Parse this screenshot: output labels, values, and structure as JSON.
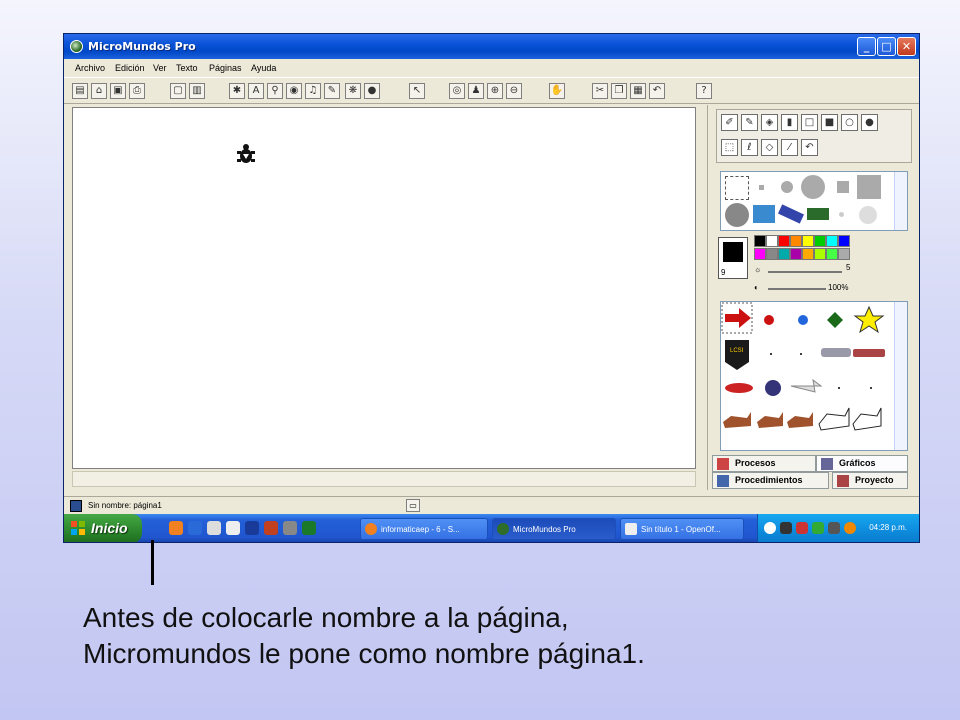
{
  "window": {
    "title": "MicroMundos Pro",
    "buttons": {
      "minimize": "_",
      "maximize": "□",
      "close": "✕"
    }
  },
  "menu": [
    "Archivo",
    "Edición",
    "Ver",
    "Texto",
    "Páginas",
    "Ayuda"
  ],
  "status": {
    "page_label": "Sin nombre:  página1"
  },
  "side_panel": {
    "current_color_number": "9",
    "pen_size": "5",
    "opacity": "100%",
    "tabs": {
      "procesos": "Procesos",
      "graficos": "Gráficos",
      "procedimientos": "Procedimientos",
      "proyecto": "Proyecto"
    }
  },
  "taskbar": {
    "start_label": "Inicio",
    "tasks": [
      "informaticaep - 6 - S...",
      "MicroMundos Pro",
      "Sin título 1 - OpenOf..."
    ],
    "clock": "04:28 p.m."
  },
  "caption": {
    "line1": "Antes de colocarle nombre a la página,",
    "line2": "Micromundos le pone como nombre página1."
  },
  "colors": {
    "titlebar": "#0a53d8",
    "taskbar": "#2460d8",
    "start_button": "#2f8c2f",
    "window_face": "#ece9d8",
    "palette": [
      "#000000",
      "#ffffff",
      "#ff0000",
      "#ff8800",
      "#ffff00",
      "#00cc00",
      "#00ffff",
      "#0000ff",
      "#ff00ff",
      "#888888",
      "#00aaaa",
      "#aa00aa",
      "#ffaa00",
      "#aaff00",
      "#44ff44",
      "#aaaaaa"
    ]
  }
}
